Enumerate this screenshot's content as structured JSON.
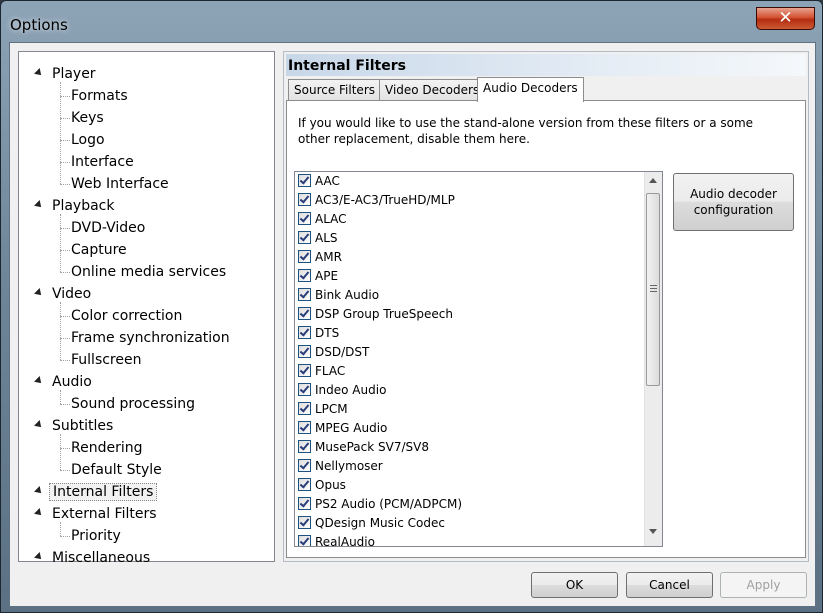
{
  "window": {
    "title": "Options",
    "close_glyph": "✕"
  },
  "tree": {
    "nodes": [
      {
        "label": "Player",
        "level": 0
      },
      {
        "label": "Formats",
        "level": 1
      },
      {
        "label": "Keys",
        "level": 1
      },
      {
        "label": "Logo",
        "level": 1
      },
      {
        "label": "Interface",
        "level": 1
      },
      {
        "label": "Web Interface",
        "level": 1
      },
      {
        "label": "Playback",
        "level": 0
      },
      {
        "label": "DVD-Video",
        "level": 1
      },
      {
        "label": "Capture",
        "level": 1
      },
      {
        "label": "Online media services",
        "level": 1
      },
      {
        "label": "Video",
        "level": 0
      },
      {
        "label": "Color correction",
        "level": 1
      },
      {
        "label": "Frame synchronization",
        "level": 1
      },
      {
        "label": "Fullscreen",
        "level": 1
      },
      {
        "label": "Audio",
        "level": 0
      },
      {
        "label": "Sound processing",
        "level": 1
      },
      {
        "label": "Subtitles",
        "level": 0
      },
      {
        "label": "Rendering",
        "level": 1
      },
      {
        "label": "Default Style",
        "level": 1
      },
      {
        "label": "Internal Filters",
        "level": 0,
        "selected": true
      },
      {
        "label": "External Filters",
        "level": 0
      },
      {
        "label": "Priority",
        "level": 1
      },
      {
        "label": "Miscellaneous",
        "level": 0
      }
    ]
  },
  "panel": {
    "header": "Internal Filters",
    "tabs": [
      "Source Filters",
      "Video Decoders",
      "Audio Decoders"
    ],
    "active_tab": 2,
    "description": "If you would like to use the stand-alone version from these filters or a some other replacement, disable them here.",
    "decoders": [
      {
        "label": "AAC",
        "checked": true
      },
      {
        "label": "AC3/E-AC3/TrueHD/MLP",
        "checked": true
      },
      {
        "label": "ALAC",
        "checked": true
      },
      {
        "label": "ALS",
        "checked": true
      },
      {
        "label": "AMR",
        "checked": true
      },
      {
        "label": "APE",
        "checked": true
      },
      {
        "label": "Bink Audio",
        "checked": true
      },
      {
        "label": "DSP Group TrueSpeech",
        "checked": true
      },
      {
        "label": "DTS",
        "checked": true
      },
      {
        "label": "DSD/DST",
        "checked": true
      },
      {
        "label": "FLAC",
        "checked": true
      },
      {
        "label": "Indeo Audio",
        "checked": true
      },
      {
        "label": "LPCM",
        "checked": true
      },
      {
        "label": "MPEG Audio",
        "checked": true
      },
      {
        "label": "MusePack SV7/SV8",
        "checked": true
      },
      {
        "label": "Nellymoser",
        "checked": true
      },
      {
        "label": "Opus",
        "checked": true
      },
      {
        "label": "PS2 Audio (PCM/ADPCM)",
        "checked": true
      },
      {
        "label": "QDesign Music Codec",
        "checked": true
      },
      {
        "label": "RealAudio",
        "checked": true
      }
    ],
    "config_button": "Audio decoder configuration"
  },
  "buttons": {
    "ok": "OK",
    "cancel": "Cancel",
    "apply": "Apply"
  },
  "icons": {
    "tree_expanded": "expanded-arrow-icon",
    "scroll_up": "scroll-up-icon",
    "scroll_down": "scroll-down-icon",
    "grip": "scroll-grip-icon",
    "check": "check-icon"
  },
  "colors": {
    "header_gradient_start": "#c8d7e8",
    "close_button": "#d45233"
  }
}
